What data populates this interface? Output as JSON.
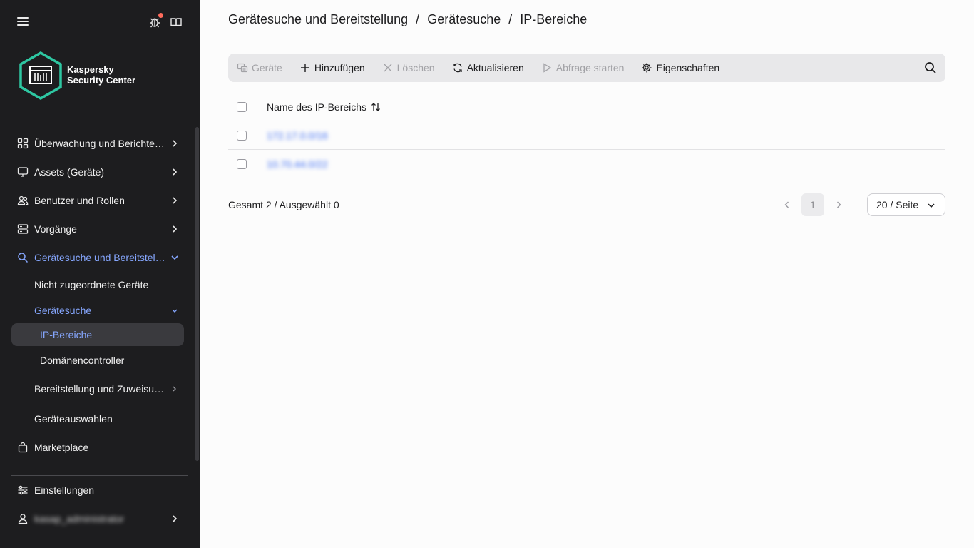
{
  "app": {
    "brand_line1": "Kaspersky",
    "brand_line2": "Security Center"
  },
  "sidebar": {
    "items": [
      {
        "label": "Überwachung und Berichter…",
        "icon": "dashboard-icon"
      },
      {
        "label": "Assets (Geräte)",
        "icon": "monitor-icon"
      },
      {
        "label": "Benutzer und Rollen",
        "icon": "users-icon"
      },
      {
        "label": "Vorgänge",
        "icon": "server-icon"
      },
      {
        "label": "Gerätesuche und Bereitstell…",
        "icon": "search-icon"
      }
    ],
    "sub_items": [
      {
        "label": "Nicht zugeordnete Geräte"
      },
      {
        "label": "Gerätesuche"
      },
      {
        "label": "Bereitstellung und Zuweisu…"
      },
      {
        "label": "Geräteauswahlen"
      }
    ],
    "sub_sub_items": [
      {
        "label": "IP-Bereiche"
      },
      {
        "label": "Domänencontroller"
      }
    ],
    "marketplace": "Marketplace",
    "settings": "Einstellungen",
    "user": "kasap_administrator"
  },
  "header": {
    "crumb1": "Gerätesuche und Bereitstellung",
    "crumb2": "Gerätesuche",
    "crumb3": "IP-Bereiche",
    "separator": "/"
  },
  "toolbar": {
    "devices": "Geräte",
    "add": "Hinzufügen",
    "delete": "Löschen",
    "refresh": "Aktualisieren",
    "start_query": "Abfrage starten",
    "properties": "Eigenschaften"
  },
  "table": {
    "column_name": "Name des IP-Bereichs",
    "rows": [
      {
        "name": "172.17.0.0/16"
      },
      {
        "name": "10.70.44.0/22"
      }
    ]
  },
  "footer": {
    "summary": "Gesamt 2 / Ausgewählt 0",
    "page": "1",
    "page_size": "20 / Seite"
  },
  "colors": {
    "sidebar_bg": "#1d1d1f",
    "accent": "#86a7ff",
    "brand_teal": "#2ec7a2",
    "link": "#3b6cf5"
  }
}
